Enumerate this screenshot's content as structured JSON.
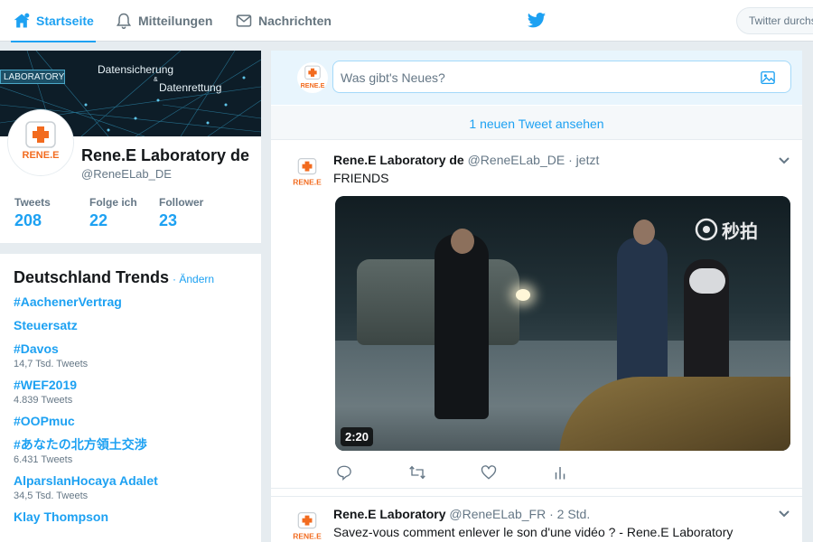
{
  "nav": {
    "home_label": "Startseite",
    "notifications_label": "Mitteilungen",
    "messages_label": "Nachrichten",
    "search_placeholder": "Twitter durchs"
  },
  "profile": {
    "banner_lab": "LABORATORY",
    "banner_line1": "Datensicherung",
    "banner_amp": "&",
    "banner_line2": "Datenrettung",
    "avatar_text": "RENE.E",
    "name": "Rene.E Laboratory de",
    "handle": "@ReneELab_DE",
    "stats": [
      {
        "label": "Tweets",
        "value": "208"
      },
      {
        "label": "Folge ich",
        "value": "22"
      },
      {
        "label": "Follower",
        "value": "23"
      }
    ]
  },
  "trends": {
    "title": "Deutschland Trends",
    "change_label": "· Ändern",
    "items": [
      {
        "name": "#AachenerVertrag",
        "count": ""
      },
      {
        "name": "Steuersatz",
        "count": ""
      },
      {
        "name": "#Davos",
        "count": "14,7 Tsd. Tweets"
      },
      {
        "name": "#WEF2019",
        "count": "4.839 Tweets"
      },
      {
        "name": "#OOPmuc",
        "count": ""
      },
      {
        "name": "#あなたの北方領土交渉",
        "count": "6.431 Tweets"
      },
      {
        "name": "AlparslanHocaya Adalet",
        "count": "34,5 Tsd. Tweets"
      },
      {
        "name": "Klay Thompson",
        "count": ""
      }
    ]
  },
  "composer": {
    "avatar_text": "RENE.E",
    "placeholder": "Was gibt's Neues?"
  },
  "new_tweets_label": "1 neuen Tweet ansehen",
  "tweets": [
    {
      "avatar_text": "RENE.E",
      "name": "Rene.E Laboratory de",
      "handle": "@ReneELab_DE",
      "time": "jetzt",
      "text": "FRIENDS",
      "video_duration": "2:20",
      "video_watermark": "秒拍"
    },
    {
      "avatar_text": "RENE.E",
      "name": "Rene.E Laboratory",
      "handle": "@ReneELab_FR",
      "time": "2 Std.",
      "text": "Savez-vous comment enlever le son d'une vidéo ? - Rene.E Laboratory"
    }
  ],
  "colors": {
    "accent": "#1da1f2",
    "brand_orange": "#f26b1f"
  },
  "icons": {
    "home": "home-icon",
    "notifications": "bell-icon",
    "messages": "envelope-icon",
    "logo": "twitter-bird-icon",
    "photo": "image-icon",
    "reply": "reply-icon",
    "retweet": "retweet-icon",
    "like": "heart-icon",
    "analytics": "analytics-icon",
    "caret": "chevron-down-icon"
  }
}
